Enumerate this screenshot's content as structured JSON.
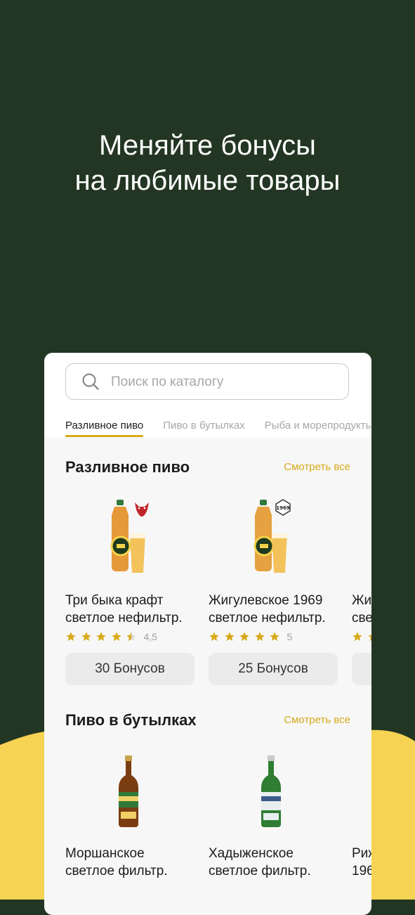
{
  "headline": {
    "line1": "Меняйте бонусы",
    "line2": "на любимые товары"
  },
  "search": {
    "placeholder": "Поиск по каталогу"
  },
  "tabs": [
    {
      "label": "Разливное пиво",
      "active": true
    },
    {
      "label": "Пиво в бутылках",
      "active": false
    },
    {
      "label": "Рыба и морепродукты",
      "active": false
    }
  ],
  "sections": [
    {
      "title": "Разливное пиво",
      "see_all": "Смотреть все",
      "products": [
        {
          "name_line1": "Три быка крафт",
          "name_line2": "светлое нефильтр.",
          "rating": 4.5,
          "rating_label": "4,5",
          "price": "30 Бонусов"
        },
        {
          "name_line1": "Жигулевское 1969",
          "name_line2": "светлое нефильтр.",
          "rating": 5,
          "rating_label": "5",
          "price": "25 Бонусов"
        },
        {
          "name_line1": "Жи",
          "name_line2": "све",
          "rating": 2,
          "rating_label": "",
          "price": ""
        }
      ]
    },
    {
      "title": "Пиво в бутылках",
      "see_all": "Смотреть все",
      "products": [
        {
          "name_line1": "Моршанское",
          "name_line2": "светлое фильтр."
        },
        {
          "name_line1": "Хадыженское",
          "name_line2": "светлое фильтр."
        },
        {
          "name_line1": "Риж",
          "name_line2": "196"
        }
      ]
    }
  ],
  "colors": {
    "dark_green": "#233623",
    "accent": "#d8a91b",
    "yellow": "#f7d353"
  }
}
